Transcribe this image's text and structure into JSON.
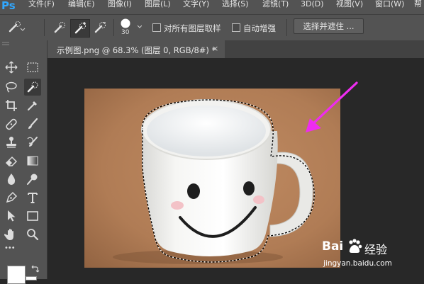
{
  "app": {
    "logo": "Ps"
  },
  "menu": [
    "文件(F)",
    "编辑(E)",
    "图像(I)",
    "图层(L)",
    "文字(Y)",
    "选择(S)",
    "滤镜(T)",
    "3D(D)",
    "视图(V)",
    "窗口(W)",
    "帮"
  ],
  "options": {
    "brush_size": "30",
    "sample_all_layers": "对所有图层取样",
    "auto_enhance": "自动增强",
    "select_and_mask": "选择并遮住 ..."
  },
  "document_tab": {
    "label": "示例图.png @ 68.3% (图层 0, RGB/8#) *",
    "close": "×"
  },
  "toolbar": {
    "more": "•••"
  },
  "watermark": {
    "brand": "Bai",
    "brand2": "经验",
    "url": "jingyan.baidu.com"
  },
  "colors": {
    "menubar": "#535353",
    "canvas_bg": "#282828",
    "backdrop": "#b07c55",
    "arrow": "#ee2cf0"
  },
  "icons": [
    "quick-selection-icon",
    "move-icon",
    "marquee-icon",
    "lasso-icon",
    "crop-icon",
    "eyedropper-icon",
    "healing-brush-icon",
    "brush-icon",
    "clone-stamp-icon",
    "history-brush-icon",
    "eraser-icon",
    "gradient-icon",
    "blur-icon",
    "dodge-icon",
    "pen-icon",
    "type-icon",
    "path-selection-icon",
    "rectangle-icon",
    "hand-icon",
    "zoom-icon"
  ]
}
